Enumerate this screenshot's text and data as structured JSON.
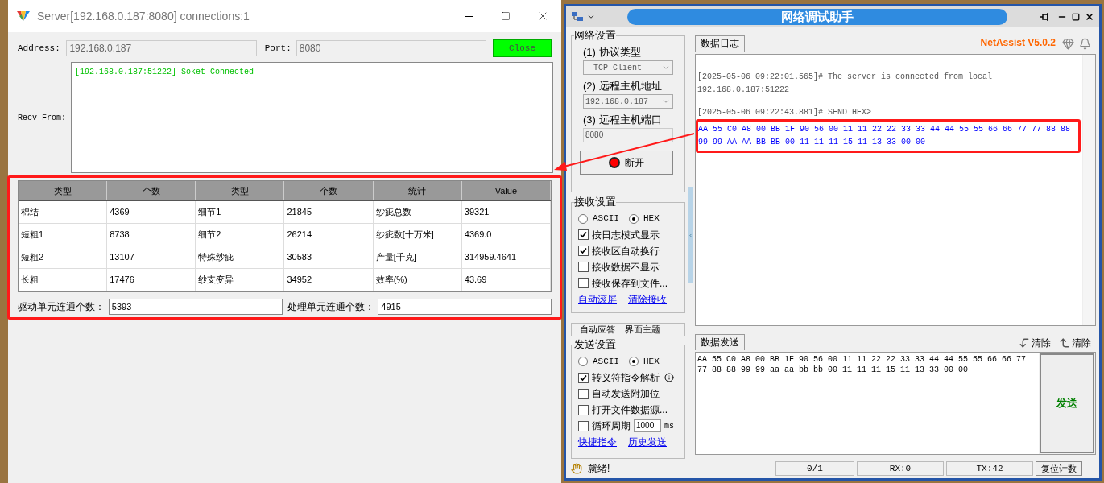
{
  "server_window": {
    "title": "Server[192.168.0.187:8080] connections:1",
    "address_label": "Address:",
    "address": "192.168.0.187",
    "port_label": "Port:",
    "port": "8080",
    "close_button": "Close",
    "recv_label": "Recv From:",
    "recv_lines": [
      "[192.168.0.187:51222] Soket Connected"
    ],
    "table": {
      "columns": [
        "类型",
        "个数",
        "类型",
        "个数",
        "统计",
        "Value"
      ],
      "rows": [
        [
          "棉结",
          "4369",
          "细节1",
          "21845",
          "纱疵总数",
          "39321"
        ],
        [
          "短粗1",
          "8738",
          "细节2",
          "26214",
          "纱疵数[十万米]",
          "4369.0"
        ],
        [
          "短粗2",
          "13107",
          "特殊纱疵",
          "30583",
          "产量[千克]",
          "314959.4641"
        ],
        [
          "长粗",
          "17476",
          "纱支变异",
          "34952",
          "效率(%)",
          "43.69"
        ]
      ]
    },
    "drive_label": "驱动单元连通个数：",
    "drive_value": "5393",
    "process_label": "处理单元连通个数：",
    "process_value": "4915"
  },
  "assist_window": {
    "title": "网络调试助手",
    "network_settings": {
      "title": "网络设置",
      "protocol_label": "(1) 协议类型",
      "protocol": "TCP Client",
      "host_label": "(2) 远程主机地址",
      "host": "192.168.0.187",
      "port_label": "(3) 远程主机端口",
      "port": "8080",
      "disconnect_button": "断开"
    },
    "receive_settings": {
      "title": "接收设置",
      "modes": [
        {
          "label": "ASCII",
          "selected": false
        },
        {
          "label": "HEX",
          "selected": true
        }
      ],
      "options": [
        {
          "label": "按日志模式显示",
          "checked": true
        },
        {
          "label": "接收区自动换行",
          "checked": true
        },
        {
          "label": "接收数据不显示",
          "checked": false
        },
        {
          "label": "接收保存到文件...",
          "checked": false
        }
      ],
      "links": [
        "自动滚屏",
        "清除接收"
      ]
    },
    "more_tabs": [
      "自动应答",
      "界面主题"
    ],
    "send_settings": {
      "title": "发送设置",
      "modes": [
        {
          "label": "ASCII",
          "selected": false
        },
        {
          "label": "HEX",
          "selected": true
        }
      ],
      "options": [
        {
          "kind": "info",
          "label": "转义符指令解析",
          "checked": true
        },
        {
          "kind": "plain",
          "label": "自动发送附加位",
          "checked": false
        },
        {
          "kind": "plain",
          "label": "打开文件数据源...",
          "checked": false
        },
        {
          "kind": "period",
          "label": "循环周期",
          "checked": false,
          "value": "1000",
          "unit": "ms"
        }
      ],
      "links": [
        "快捷指令",
        "历史发送"
      ]
    },
    "log_tab": "数据日志",
    "version_link": "NetAssist V5.0.2",
    "log": [
      {
        "kind": "info",
        "lines": [
          "[2025-05-06 09:22:01.565]# The server is connected from local",
          "192.168.0.187:51222"
        ]
      },
      {
        "kind": "info",
        "lines": [
          "[2025-05-06 09:22:43.881]# SEND HEX>"
        ]
      },
      {
        "kind": "hex",
        "lines": [
          "AA 55 C0 A8 00 BB 1F 90 56 00 11 11 22 22 33 33 44 44 55 55 66 66 77 77 88 88",
          "99 99 AA AA BB BB 00 11 11 11 15 11 13 33 00 00"
        ]
      }
    ],
    "send_tab": "数据发送",
    "clear_buttons": [
      "清除",
      "清除"
    ],
    "send_lines": [
      "AA 55 C0 A8 00 BB 1F 90 56 00 11 11 22 22 33 33 44 44 55 55 66 66 77",
      "77 88 88 99 99 aa aa bb bb 00 11 11 11 15 11 13 33 00 00"
    ],
    "send_button": "发送",
    "status": {
      "text": "就绪!",
      "counts": "0/1",
      "rx": "RX:0",
      "tx": "TX:42",
      "reset_button": "复位计数"
    }
  }
}
